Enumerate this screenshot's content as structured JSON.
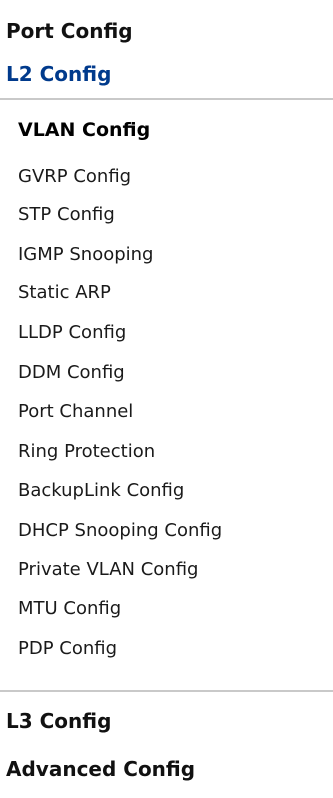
{
  "menu": {
    "port_config": "Port Config",
    "l2_config": "L2 Config",
    "l2_items": [
      "VLAN Config",
      "GVRP Config",
      "STP Config",
      "IGMP Snooping",
      "Static ARP",
      "LLDP Config",
      "DDM Config",
      "Port Channel",
      "Ring Protection",
      "BackupLink Config",
      "DHCP Snooping Config",
      "Private VLAN Config",
      "MTU Config",
      "PDP Config"
    ],
    "l3_config": "L3 Config",
    "advanced_config": "Advanced Config"
  },
  "theme": {
    "active_section_color": "#003a8c",
    "divider_color": "#c9c9c9"
  }
}
